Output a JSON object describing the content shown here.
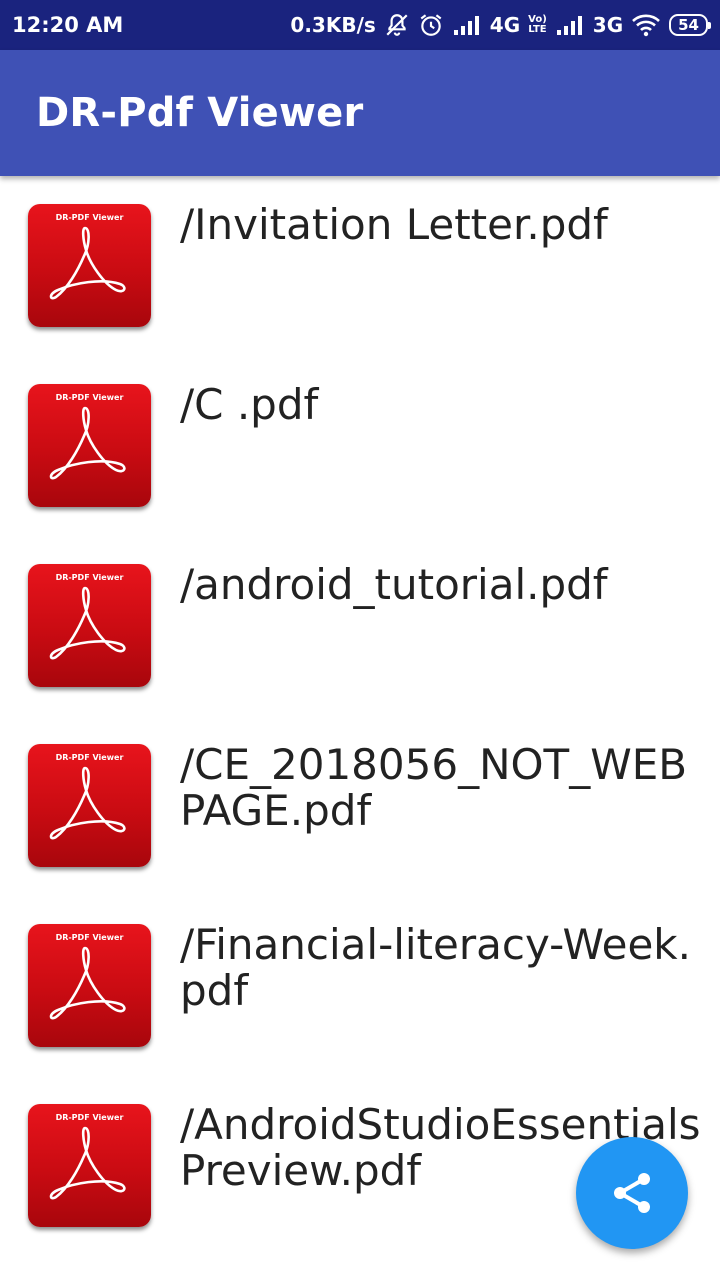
{
  "status_bar": {
    "time": "12:20 AM",
    "net_speed": "0.3KB/s",
    "network_1": "4G",
    "volte_top": "Vo)",
    "volte_bottom": "LTE",
    "network_2": "3G",
    "battery": "54",
    "icons": [
      "mute-alarm-icon",
      "alarm-icon",
      "signal-icon",
      "signal-icon",
      "wifi-icon",
      "battery-icon"
    ]
  },
  "app_bar": {
    "title": "DR-Pdf Viewer",
    "color": "#3f51b5"
  },
  "files": [
    {
      "name": "/Invitation Letter.pdf",
      "icon_caption": "DR-PDF Viewer"
    },
    {
      "name": "/C .pdf",
      "icon_caption": "DR-PDF Viewer"
    },
    {
      "name": "/android_tutorial.pdf",
      "icon_caption": "DR-PDF Viewer"
    },
    {
      "name": "/CE_2018056_NOT_WEBPAGE.pdf",
      "icon_caption": "DR-PDF Viewer"
    },
    {
      "name": "/Financial-literacy-Week.pdf",
      "icon_caption": "DR-PDF Viewer"
    },
    {
      "name": "/AndroidStudioEssentialsPreview.pdf",
      "icon_caption": "DR-PDF Viewer"
    }
  ],
  "fab": {
    "icon": "share-icon",
    "color": "#2196f3"
  }
}
